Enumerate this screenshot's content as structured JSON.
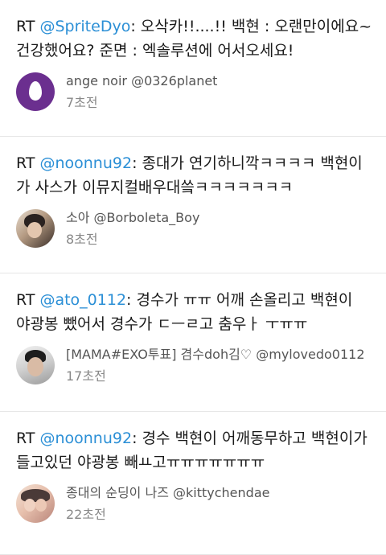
{
  "tweets": [
    {
      "prefix": "RT ",
      "mention": "@SpriteDyo",
      "line1_rest": ": 오삭카!!....!! 백현 : 오랜만이에요~",
      "line2": "건강했어요? 준면 : 엑솔루션에 어서오세요!",
      "author": "ange noir @0326planet",
      "time": "7초전",
      "avatar_icon": "egg-icon"
    },
    {
      "prefix": "RT ",
      "mention": "@noonnu92",
      "line1_rest": ": 종대가 연기하니깍ㅋㅋㅋㅋ 백현이",
      "line2": "가 사스가 이뮤지컬배우대씈ㅋㅋㅋㅋㅋㅋㅋ",
      "author": "소아 @Borboleta_Boy",
      "time": "8초전",
      "avatar_icon": "profile-photo"
    },
    {
      "prefix": "RT ",
      "mention": "@ato_0112",
      "line1_rest": ": 경수가 ㅠㅠ 어깨 손올리고 백현이",
      "line2": "야광봉 뺐어서 경수가 ㄷㅡㄹ고 춤우ㅏ ㅜㅠㅠ",
      "author": "[MAMA#EXO투표] 겸수doh김♡ @mylovedo0112",
      "time": "17초전",
      "avatar_icon": "profile-photo"
    },
    {
      "prefix": "RT ",
      "mention": "@noonnu92",
      "line1_rest": ": 경수 백현이 어깨동무하고 백현이가",
      "line2": "들고있던 야광봉 빼ㅛ고ㅠㅠㅠㅠㅠㅠㅠ",
      "author": "종대의 순딩이 나즈 @kittychendae",
      "time": "22초전",
      "avatar_icon": "profile-photo"
    }
  ],
  "colors": {
    "mention": "#2b8fd6",
    "text": "#1a1a1a",
    "meta": "#555555",
    "time": "#888888",
    "divider": "#e6e6e6"
  }
}
